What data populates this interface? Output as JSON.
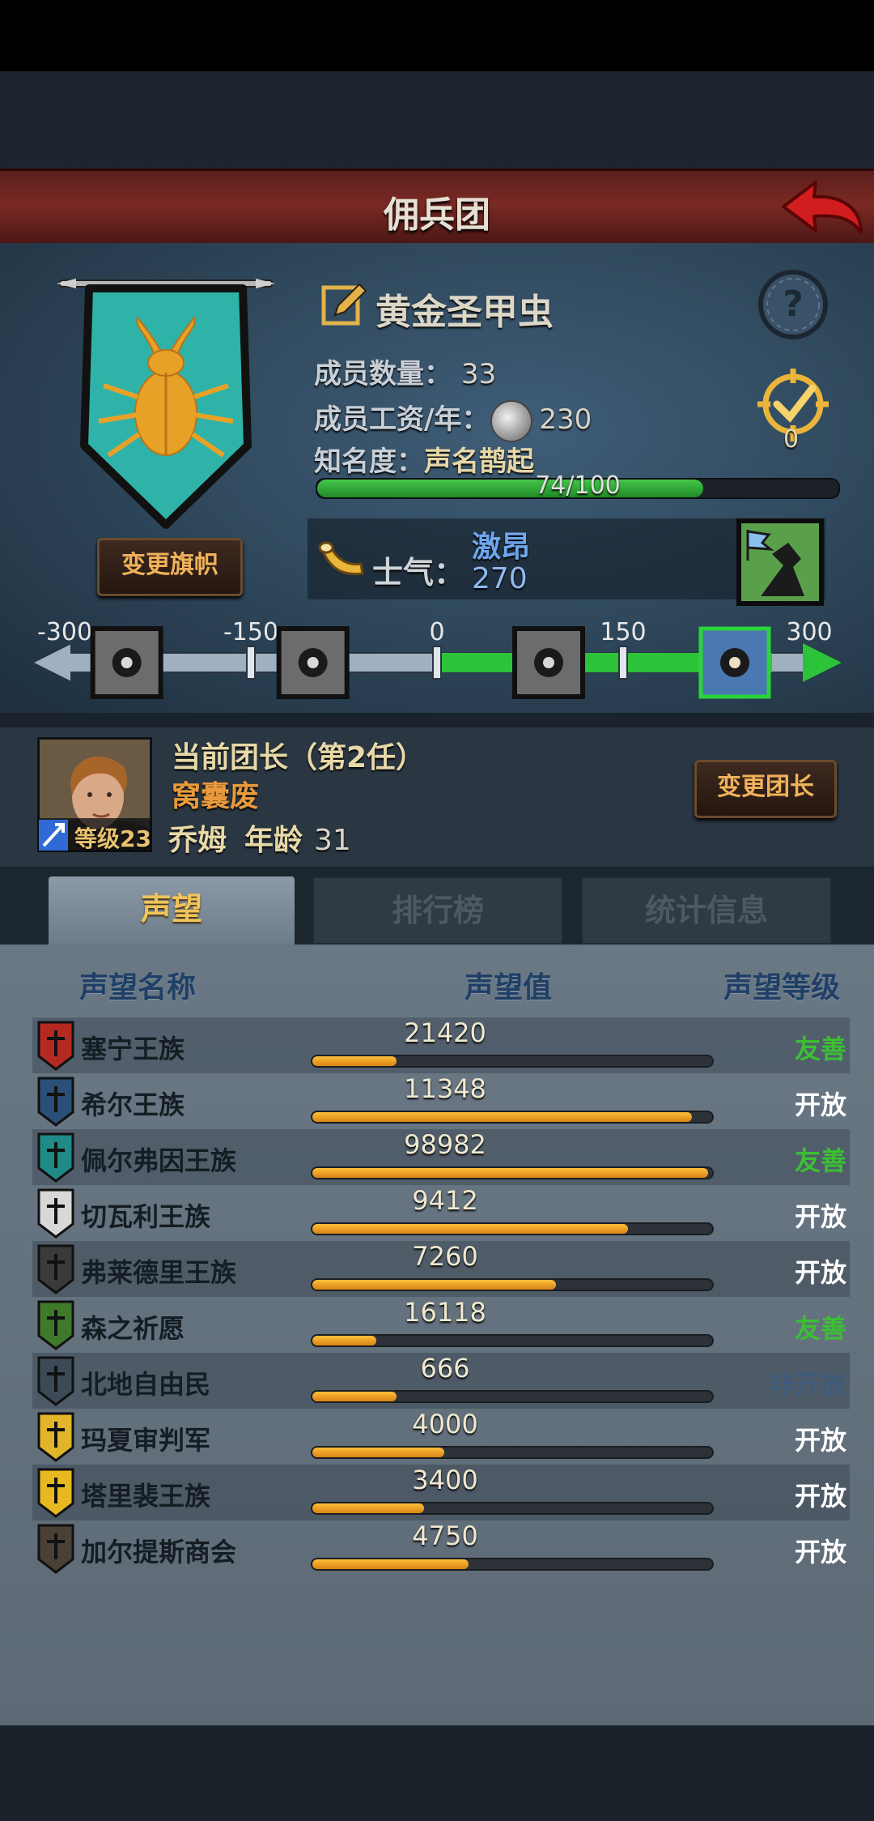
{
  "header": {
    "title": "佣兵团"
  },
  "company": {
    "name": "黄金圣甲虫",
    "members_label": "成员数量：",
    "members_value": "33",
    "wage_label": "成员工资/年：",
    "wage_value": "230",
    "fame_label": "知名度：",
    "fame_level": "声名鹊起",
    "fame_progress_text": "74/100",
    "fame_progress": 0.74,
    "medal_count": "0",
    "change_banner_label": "变更旗帜",
    "banner_color": "#2fb3a8",
    "emblem_color": "#e8a127"
  },
  "morale": {
    "label": "士气：",
    "state": "激昂",
    "value": "270",
    "scale_min": -300,
    "scale_max": 300,
    "scale_ticks": [
      "-300",
      "-150",
      "0",
      "150",
      "300"
    ],
    "icons": [
      "eye-icon",
      "despair-icon",
      "neutral-icon",
      "flag-icon"
    ]
  },
  "leader": {
    "title": "当前团长（第2任）",
    "trait": "窝囊废",
    "name": "乔姆",
    "age_label": "年龄",
    "age": "31",
    "level_text": "等级23",
    "change_label": "变更团长"
  },
  "tabs": [
    {
      "label": "声望",
      "active": true
    },
    {
      "label": "排行榜",
      "active": false
    },
    {
      "label": "统计信息",
      "active": false
    }
  ],
  "reputation": {
    "headers": {
      "name": "声望名称",
      "value": "声望值",
      "level": "声望等级"
    },
    "rows": [
      {
        "name": "塞宁王族",
        "value": "21420",
        "fill": 0.21,
        "level": "友善",
        "level_color": "#3cbf33",
        "icon_color": "#b42a22"
      },
      {
        "name": "希尔王族",
        "value": "11348",
        "fill": 0.95,
        "level": "开放",
        "level_color": "#ffffff",
        "icon_color": "#2a4f78"
      },
      {
        "name": "佩尔弗因王族",
        "value": "98982",
        "fill": 0.99,
        "level": "友善",
        "level_color": "#3cbf33",
        "icon_color": "#1f8a86"
      },
      {
        "name": "切瓦利王族",
        "value": "9412",
        "fill": 0.79,
        "level": "开放",
        "level_color": "#ffffff",
        "icon_color": "#d8d8d8"
      },
      {
        "name": "弗莱德里王族",
        "value": "7260",
        "fill": 0.61,
        "level": "开放",
        "level_color": "#ffffff",
        "icon_color": "#3a3a3a"
      },
      {
        "name": "森之祈愿",
        "value": "16118",
        "fill": 0.16,
        "level": "友善",
        "level_color": "#3cbf33",
        "icon_color": "#3f7a2a"
      },
      {
        "name": "北地自由民",
        "value": "666",
        "fill": 0.21,
        "level": "非开放",
        "level_color": "#3e5a7c",
        "icon_color": "#3c4a58"
      },
      {
        "name": "玛夏审判军",
        "value": "4000",
        "fill": 0.33,
        "level": "开放",
        "level_color": "#ffffff",
        "icon_color": "#e0b52a"
      },
      {
        "name": "塔里裴王族",
        "value": "3400",
        "fill": 0.28,
        "level": "开放",
        "level_color": "#ffffff",
        "icon_color": "#e8b820"
      },
      {
        "name": "加尔提斯商会",
        "value": "4750",
        "fill": 0.39,
        "level": "开放",
        "level_color": "#ffffff",
        "icon_color": "#4a4036"
      }
    ]
  }
}
